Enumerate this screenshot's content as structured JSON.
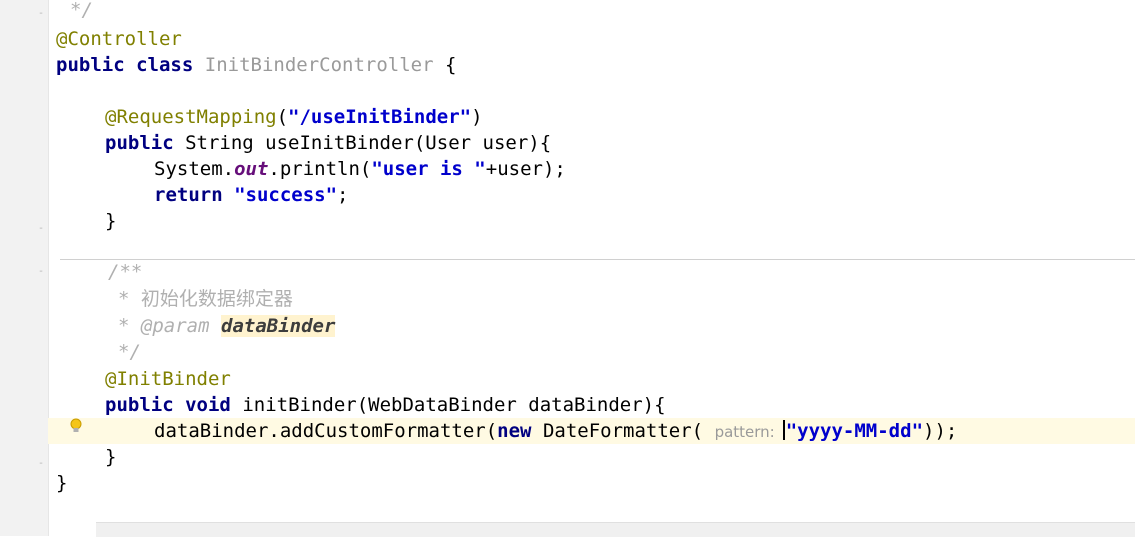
{
  "editor": {
    "top_comment_end": "*/",
    "annotation_controller": "@Controller",
    "kw_public": "public",
    "kw_class": "class",
    "class_name": "InitBinderController",
    "open_brace": "{",
    "request_mapping_annotation": "@RequestMapping",
    "request_mapping_open": "(",
    "request_mapping_path": "\"/useInitBinder\"",
    "request_mapping_close": ")",
    "method1_public": "public",
    "method1_signature": "String useInitBinder(User user){",
    "println_prefix": "System.",
    "println_out": "out",
    "println_mid": ".println(",
    "println_string": "\"user is \"",
    "println_suffix": "+user);",
    "kw_return": "return",
    "return_value": "\"success\"",
    "semicolon": ";",
    "method1_close": "}",
    "doc_open": "/**",
    "doc_desc_star": "*",
    "doc_desc": "初始化数据绑定器",
    "doc_param_star": "*",
    "doc_param_tag": "@param",
    "doc_param_name": "dataBinder",
    "doc_close": "*/",
    "initbinder_annotation": "@InitBinder",
    "method2_public": "public",
    "method2_void": "void",
    "method2_signature": "initBinder(WebDataBinder dataBinder){",
    "formatter_prefix": "dataBinder.addCustomFormatter(",
    "kw_new": "new",
    "formatter_class": "DateFormatter(",
    "param_hint": "pattern:",
    "pattern_value": "\"yyyy-MM-dd\"",
    "formatter_suffix": "));",
    "method2_close": "}",
    "class_close": "}"
  }
}
